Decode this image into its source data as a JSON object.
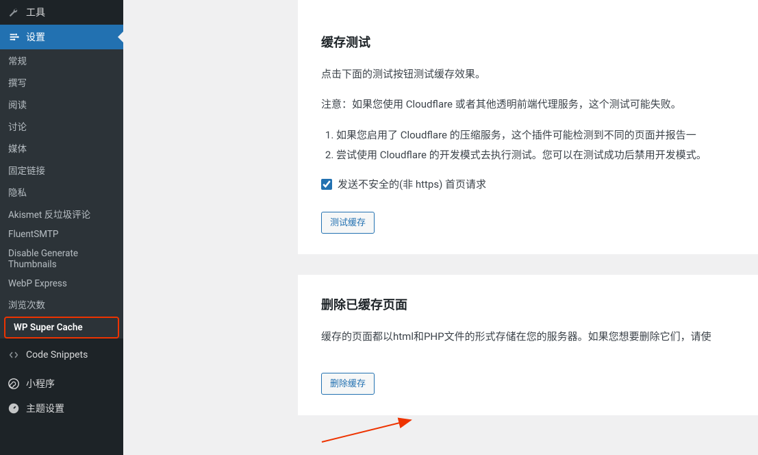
{
  "sidebar": {
    "tools": "工具",
    "settings": "设置",
    "submenu": [
      "常规",
      "撰写",
      "阅读",
      "讨论",
      "媒体",
      "固定链接",
      "隐私",
      "Akismet 反垃圾评论",
      "FluentSMTP",
      "Disable Generate Thumbnails",
      "WebP Express",
      "浏览次数",
      "WP Super Cache"
    ],
    "code_snippets": "Code Snippets",
    "miniprogram": "小程序",
    "theme_settings": "主题设置"
  },
  "cache_test": {
    "title": "缓存测试",
    "desc": "点击下面的测试按钮测试缓存效果。",
    "note_label": "注意：",
    "note_text": "如果您使用 Cloudflare 或者其他透明前端代理服务，这个测试可能失败。",
    "list1": "如果您启用了 Cloudflare 的压缩服务，这个插件可能检测到不同的页面并报告一",
    "list2": "尝试使用 Cloudflare 的开发模式去执行测试。您可以在测试成功后禁用开发模式。",
    "checkbox_label": "发送不安全的(非 https) 首页请求",
    "button": "测试缓存"
  },
  "delete_cache": {
    "title": "删除已缓存页面",
    "desc": "缓存的页面都以html和PHP文件的形式存储在您的服务器。如果您想要删除它们，请使",
    "button": "删除缓存"
  }
}
